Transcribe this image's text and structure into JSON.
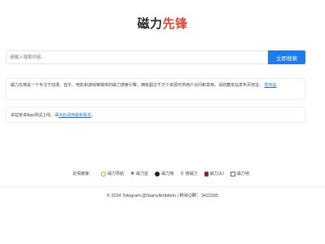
{
  "logo": {
    "part1": "磁力",
    "part2": "先锋"
  },
  "search": {
    "placeholder": "请输入搜索内容...",
    "button_label": "立即搜索"
  },
  "intro": {
    "text": "磁力先锋是一个专注于动漫、音乐、电影和游戏等媒体的磁力搜索引擎，拥有超过千万个资源可供用户访问和享用。请收藏本站发布页地址：",
    "link": "发布站"
  },
  "notice": {
    "text": "本站安卓App测试上线，请",
    "link": "点此试用最新版本",
    "suffix": "。"
  },
  "friends": {
    "label": "友情链接：",
    "links": [
      {
        "label": "磁力导航",
        "icon": "compass-icon"
      },
      {
        "label": "磁力星",
        "icon": "star-icon"
      },
      {
        "label": "磁力熊",
        "icon": "panda-icon"
      },
      {
        "label": "搜磁力",
        "icon": "search-icon"
      },
      {
        "label": "磁力UU",
        "icon": "book-icon"
      },
      {
        "label": "磁力吧",
        "icon": "document-icon"
      }
    ]
  },
  "footer": {
    "text": "© 2024 Telegram:@StarryAmbition | 粉丝Q群：3422265"
  }
}
